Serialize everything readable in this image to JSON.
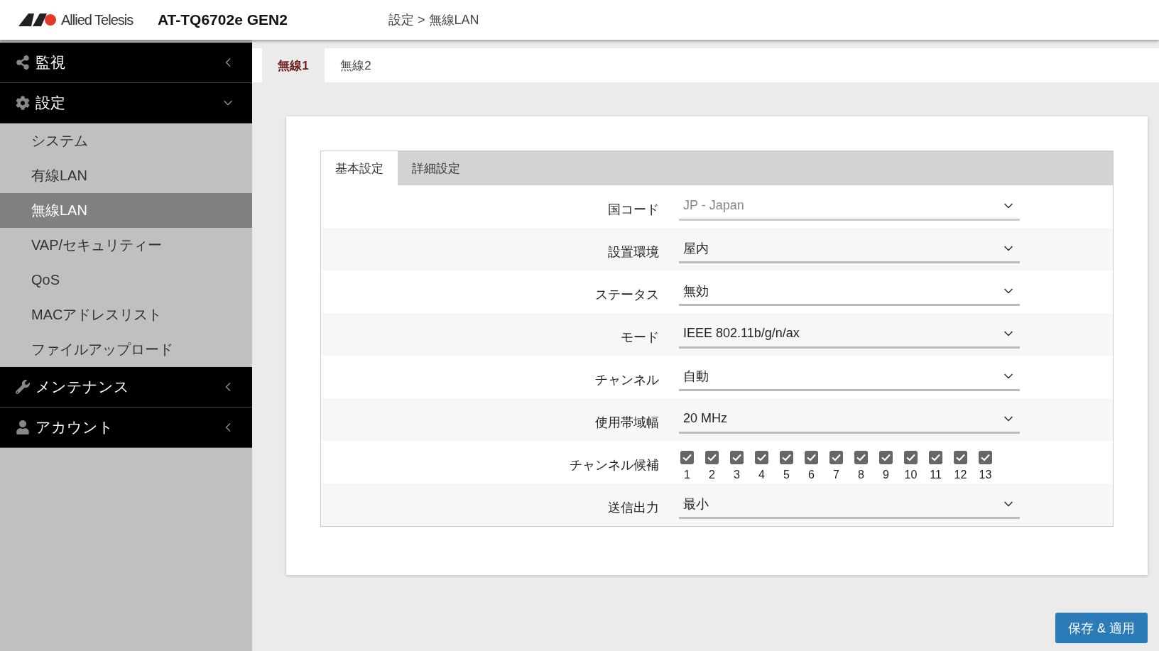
{
  "header": {
    "brand": "Allied Telesis",
    "model": "AT-TQ6702e GEN2",
    "breadcrumb": "設定 > 無線LAN"
  },
  "sidebar": {
    "groups": [
      {
        "label": "監視",
        "expanded": false
      },
      {
        "label": "設定",
        "expanded": true,
        "items": [
          {
            "label": "システム",
            "selected": false
          },
          {
            "label": "有線LAN",
            "selected": false
          },
          {
            "label": "無線LAN",
            "selected": true
          },
          {
            "label": "VAP/セキュリティー",
            "selected": false
          },
          {
            "label": "QoS",
            "selected": false
          },
          {
            "label": "MACアドレスリスト",
            "selected": false
          },
          {
            "label": "ファイルアップロード",
            "selected": false
          }
        ]
      },
      {
        "label": "メンテナンス",
        "expanded": false
      },
      {
        "label": "アカウント",
        "expanded": false
      }
    ]
  },
  "radio_tabs": [
    {
      "label": "無線1",
      "selected": true
    },
    {
      "label": "無線2",
      "selected": false
    }
  ],
  "form_tabs": [
    {
      "label": "基本設定",
      "selected": true
    },
    {
      "label": "詳細設定",
      "selected": false
    }
  ],
  "fields": [
    {
      "kind": "select",
      "label": "国コード",
      "value": "JP - Japan",
      "disabled": true
    },
    {
      "kind": "select",
      "label": "設置環境",
      "value": "屋内",
      "disabled": false
    },
    {
      "kind": "select",
      "label": "ステータス",
      "value": "無効",
      "disabled": false
    },
    {
      "kind": "select",
      "label": "モード",
      "value": "IEEE 802.11b/g/n/ax",
      "disabled": false
    },
    {
      "kind": "select",
      "label": "チャンネル",
      "value": "自動",
      "disabled": false
    },
    {
      "kind": "select",
      "label": "使用帯域幅",
      "value": "20 MHz",
      "disabled": false
    },
    {
      "kind": "checkboxes",
      "label": "チャンネル候補",
      "options": [
        {
          "label": "1",
          "checked": true
        },
        {
          "label": "2",
          "checked": true
        },
        {
          "label": "3",
          "checked": true
        },
        {
          "label": "4",
          "checked": true
        },
        {
          "label": "5",
          "checked": true
        },
        {
          "label": "6",
          "checked": true
        },
        {
          "label": "7",
          "checked": true
        },
        {
          "label": "8",
          "checked": true
        },
        {
          "label": "9",
          "checked": true
        },
        {
          "label": "10",
          "checked": true
        },
        {
          "label": "11",
          "checked": true
        },
        {
          "label": "12",
          "checked": true
        },
        {
          "label": "13",
          "checked": true
        }
      ]
    },
    {
      "kind": "select",
      "label": "送信出力",
      "value": "最小",
      "disabled": false
    }
  ],
  "save_button": "保存 & 適用"
}
